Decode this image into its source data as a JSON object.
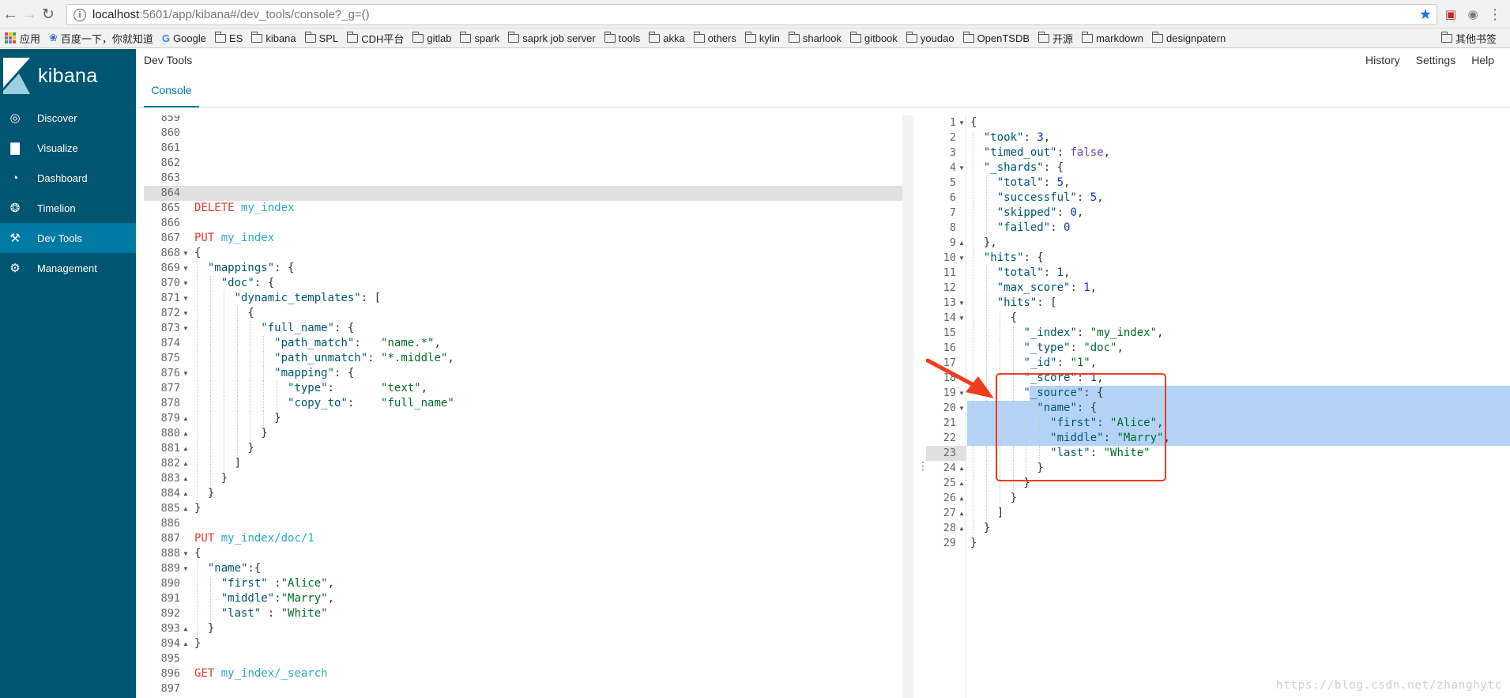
{
  "browser": {
    "url_host": "localhost",
    "url_path": ":5601/app/kibana#/dev_tools/console?_g=()",
    "bookmarks": [
      {
        "label": "应用",
        "type": "apps"
      },
      {
        "label": "百度一下，你就知道",
        "type": "paw"
      },
      {
        "label": "Google",
        "type": "google"
      },
      {
        "label": "ES",
        "type": "folder"
      },
      {
        "label": "kibana",
        "type": "folder"
      },
      {
        "label": "SPL",
        "type": "folder"
      },
      {
        "label": "CDH平台",
        "type": "folder"
      },
      {
        "label": "gitlab",
        "type": "folder"
      },
      {
        "label": "spark",
        "type": "folder"
      },
      {
        "label": "saprk job server",
        "type": "folder"
      },
      {
        "label": "tools",
        "type": "folder"
      },
      {
        "label": "akka",
        "type": "folder"
      },
      {
        "label": "others",
        "type": "folder"
      },
      {
        "label": "kylin",
        "type": "folder"
      },
      {
        "label": "sharlook",
        "type": "folder"
      },
      {
        "label": "gitbook",
        "type": "folder"
      },
      {
        "label": "youdao",
        "type": "folder"
      },
      {
        "label": "OpenTSDB",
        "type": "folder"
      },
      {
        "label": "开源",
        "type": "folder"
      },
      {
        "label": "markdown",
        "type": "folder"
      },
      {
        "label": "designpatern",
        "type": "folder"
      }
    ],
    "other_bookmarks": "其他书签"
  },
  "sidebar": {
    "logo_text": "kibana",
    "items": [
      {
        "label": "Discover",
        "icon": "compass-icon",
        "active": false
      },
      {
        "label": "Visualize",
        "icon": "bar-chart-icon",
        "active": false
      },
      {
        "label": "Dashboard",
        "icon": "dashboard-icon",
        "active": false
      },
      {
        "label": "Timelion",
        "icon": "timelion-icon",
        "active": false
      },
      {
        "label": "Dev Tools",
        "icon": "wrench-icon",
        "active": true
      },
      {
        "label": "Management",
        "icon": "gear-icon",
        "active": false
      }
    ]
  },
  "header": {
    "title": "Dev Tools",
    "actions": [
      "History",
      "Settings",
      "Help"
    ],
    "tab": "Console"
  },
  "request_editor": {
    "lines": [
      {
        "n": "859",
        "fold": "",
        "tokens": []
      },
      {
        "n": "860",
        "fold": "",
        "tokens": []
      },
      {
        "n": "861",
        "fold": "",
        "tokens": []
      },
      {
        "n": "862",
        "fold": "",
        "tokens": []
      },
      {
        "n": "863",
        "fold": "",
        "tokens": []
      },
      {
        "n": "864",
        "fold": "",
        "tokens": []
      },
      {
        "n": "865",
        "fold": "",
        "tokens": [
          [
            "m",
            "DELETE"
          ],
          [
            "p",
            " "
          ],
          [
            "u",
            "my_index"
          ]
        ]
      },
      {
        "n": "866",
        "fold": "",
        "tokens": []
      },
      {
        "n": "867",
        "fold": "",
        "tokens": [
          [
            "m",
            "PUT"
          ],
          [
            "p",
            " "
          ],
          [
            "u",
            "my_index"
          ]
        ]
      },
      {
        "n": "868",
        "fold": "open",
        "tokens": [
          [
            "p",
            "{"
          ]
        ]
      },
      {
        "n": "869",
        "fold": "open",
        "tokens": [
          [
            "p",
            "  "
          ],
          [
            "k",
            "\"mappings\""
          ],
          [
            "p",
            ": {"
          ]
        ]
      },
      {
        "n": "870",
        "fold": "open",
        "tokens": [
          [
            "p",
            "    "
          ],
          [
            "k",
            "\"doc\""
          ],
          [
            "p",
            ": {"
          ]
        ]
      },
      {
        "n": "871",
        "fold": "open",
        "tokens": [
          [
            "p",
            "      "
          ],
          [
            "k",
            "\"dynamic_templates\""
          ],
          [
            "p",
            ": ["
          ]
        ]
      },
      {
        "n": "872",
        "fold": "open",
        "tokens": [
          [
            "p",
            "        {"
          ]
        ]
      },
      {
        "n": "873",
        "fold": "open",
        "tokens": [
          [
            "p",
            "          "
          ],
          [
            "k",
            "\"full_name\""
          ],
          [
            "p",
            ": {"
          ]
        ]
      },
      {
        "n": "874",
        "fold": "",
        "tokens": [
          [
            "p",
            "            "
          ],
          [
            "k",
            "\"path_match\""
          ],
          [
            "p",
            ":   "
          ],
          [
            "s",
            "\"name.*\""
          ],
          [
            "p",
            ","
          ]
        ]
      },
      {
        "n": "875",
        "fold": "",
        "tokens": [
          [
            "p",
            "            "
          ],
          [
            "k",
            "\"path_unmatch\""
          ],
          [
            "p",
            ": "
          ],
          [
            "s",
            "\"*.middle\""
          ],
          [
            "p",
            ","
          ]
        ]
      },
      {
        "n": "876",
        "fold": "open",
        "tokens": [
          [
            "p",
            "            "
          ],
          [
            "k",
            "\"mapping\""
          ],
          [
            "p",
            ": {"
          ]
        ]
      },
      {
        "n": "877",
        "fold": "",
        "tokens": [
          [
            "p",
            "              "
          ],
          [
            "k",
            "\"type\""
          ],
          [
            "p",
            ":       "
          ],
          [
            "s",
            "\"text\""
          ],
          [
            "p",
            ","
          ]
        ]
      },
      {
        "n": "878",
        "fold": "",
        "tokens": [
          [
            "p",
            "              "
          ],
          [
            "k",
            "\"copy_to\""
          ],
          [
            "p",
            ":    "
          ],
          [
            "s",
            "\"full_name\""
          ]
        ]
      },
      {
        "n": "879",
        "fold": "close",
        "tokens": [
          [
            "p",
            "            }"
          ]
        ]
      },
      {
        "n": "880",
        "fold": "close",
        "tokens": [
          [
            "p",
            "          }"
          ]
        ]
      },
      {
        "n": "881",
        "fold": "close",
        "tokens": [
          [
            "p",
            "        }"
          ]
        ]
      },
      {
        "n": "882",
        "fold": "close",
        "tokens": [
          [
            "p",
            "      ]"
          ]
        ]
      },
      {
        "n": "883",
        "fold": "close",
        "tokens": [
          [
            "p",
            "    }"
          ]
        ]
      },
      {
        "n": "884",
        "fold": "close",
        "tokens": [
          [
            "p",
            "  }"
          ]
        ]
      },
      {
        "n": "885",
        "fold": "close",
        "tokens": [
          [
            "p",
            "}"
          ]
        ]
      },
      {
        "n": "886",
        "fold": "",
        "tokens": []
      },
      {
        "n": "887",
        "fold": "",
        "tokens": [
          [
            "m",
            "PUT"
          ],
          [
            "p",
            " "
          ],
          [
            "u",
            "my_index/doc/1"
          ]
        ]
      },
      {
        "n": "888",
        "fold": "open",
        "tokens": [
          [
            "p",
            "{"
          ]
        ]
      },
      {
        "n": "889",
        "fold": "open",
        "tokens": [
          [
            "p",
            "  "
          ],
          [
            "k",
            "\"name\""
          ],
          [
            "p",
            ":{"
          ]
        ]
      },
      {
        "n": "890",
        "fold": "",
        "tokens": [
          [
            "p",
            "    "
          ],
          [
            "k",
            "\"first\""
          ],
          [
            "p",
            " :"
          ],
          [
            "s",
            "\"Alice\""
          ],
          [
            "p",
            ","
          ]
        ]
      },
      {
        "n": "891",
        "fold": "",
        "tokens": [
          [
            "p",
            "    "
          ],
          [
            "k",
            "\"middle\""
          ],
          [
            "p",
            ":"
          ],
          [
            "s",
            "\"Marry\""
          ],
          [
            "p",
            ","
          ]
        ]
      },
      {
        "n": "892",
        "fold": "",
        "tokens": [
          [
            "p",
            "    "
          ],
          [
            "k",
            "\"last\""
          ],
          [
            "p",
            " : "
          ],
          [
            "s",
            "\"White\""
          ]
        ]
      },
      {
        "n": "893",
        "fold": "close",
        "tokens": [
          [
            "p",
            "  }"
          ]
        ]
      },
      {
        "n": "894",
        "fold": "close",
        "tokens": [
          [
            "p",
            "}"
          ]
        ]
      },
      {
        "n": "895",
        "fold": "",
        "tokens": []
      },
      {
        "n": "896",
        "fold": "",
        "tokens": [
          [
            "m",
            "GET"
          ],
          [
            "p",
            " "
          ],
          [
            "u",
            "my_index/_search"
          ]
        ]
      },
      {
        "n": "897",
        "fold": "",
        "tokens": []
      }
    ]
  },
  "response_editor": {
    "lines": [
      {
        "n": "1",
        "fold": "open",
        "tokens": [
          [
            "p",
            "{"
          ]
        ]
      },
      {
        "n": "2",
        "fold": "",
        "tokens": [
          [
            "p",
            "  "
          ],
          [
            "k",
            "\"took\""
          ],
          [
            "p",
            ": "
          ],
          [
            "n",
            "3"
          ],
          [
            "p",
            ","
          ]
        ]
      },
      {
        "n": "3",
        "fold": "",
        "tokens": [
          [
            "p",
            "  "
          ],
          [
            "k",
            "\"timed_out\""
          ],
          [
            "p",
            ": "
          ],
          [
            "b",
            "false"
          ],
          [
            "p",
            ","
          ]
        ]
      },
      {
        "n": "4",
        "fold": "open",
        "tokens": [
          [
            "p",
            "  "
          ],
          [
            "k",
            "\"_shards\""
          ],
          [
            "p",
            ": {"
          ]
        ]
      },
      {
        "n": "5",
        "fold": "",
        "tokens": [
          [
            "p",
            "    "
          ],
          [
            "k",
            "\"total\""
          ],
          [
            "p",
            ": "
          ],
          [
            "n",
            "5"
          ],
          [
            "p",
            ","
          ]
        ]
      },
      {
        "n": "6",
        "fold": "",
        "tokens": [
          [
            "p",
            "    "
          ],
          [
            "k",
            "\"successful\""
          ],
          [
            "p",
            ": "
          ],
          [
            "n",
            "5"
          ],
          [
            "p",
            ","
          ]
        ]
      },
      {
        "n": "7",
        "fold": "",
        "tokens": [
          [
            "p",
            "    "
          ],
          [
            "k",
            "\"skipped\""
          ],
          [
            "p",
            ": "
          ],
          [
            "n",
            "0"
          ],
          [
            "p",
            ","
          ]
        ]
      },
      {
        "n": "8",
        "fold": "",
        "tokens": [
          [
            "p",
            "    "
          ],
          [
            "k",
            "\"failed\""
          ],
          [
            "p",
            ": "
          ],
          [
            "n",
            "0"
          ]
        ]
      },
      {
        "n": "9",
        "fold": "close",
        "tokens": [
          [
            "p",
            "  },"
          ]
        ]
      },
      {
        "n": "10",
        "fold": "open",
        "tokens": [
          [
            "p",
            "  "
          ],
          [
            "k",
            "\"hits\""
          ],
          [
            "p",
            ": {"
          ]
        ]
      },
      {
        "n": "11",
        "fold": "",
        "tokens": [
          [
            "p",
            "    "
          ],
          [
            "k",
            "\"total\""
          ],
          [
            "p",
            ": "
          ],
          [
            "n",
            "1"
          ],
          [
            "p",
            ","
          ]
        ]
      },
      {
        "n": "12",
        "fold": "",
        "tokens": [
          [
            "p",
            "    "
          ],
          [
            "k",
            "\"max_score\""
          ],
          [
            "p",
            ": "
          ],
          [
            "n",
            "1"
          ],
          [
            "p",
            ","
          ]
        ]
      },
      {
        "n": "13",
        "fold": "open",
        "tokens": [
          [
            "p",
            "    "
          ],
          [
            "k",
            "\"hits\""
          ],
          [
            "p",
            ": ["
          ]
        ]
      },
      {
        "n": "14",
        "fold": "open",
        "tokens": [
          [
            "p",
            "      {"
          ]
        ]
      },
      {
        "n": "15",
        "fold": "",
        "tokens": [
          [
            "p",
            "        "
          ],
          [
            "k",
            "\"_index\""
          ],
          [
            "p",
            ": "
          ],
          [
            "s",
            "\"my_index\""
          ],
          [
            "p",
            ","
          ]
        ]
      },
      {
        "n": "16",
        "fold": "",
        "tokens": [
          [
            "p",
            "        "
          ],
          [
            "k",
            "\"_type\""
          ],
          [
            "p",
            ": "
          ],
          [
            "s",
            "\"doc\""
          ],
          [
            "p",
            ","
          ]
        ]
      },
      {
        "n": "17",
        "fold": "",
        "tokens": [
          [
            "p",
            "        "
          ],
          [
            "k",
            "\"_id\""
          ],
          [
            "p",
            ": "
          ],
          [
            "s",
            "\"1\""
          ],
          [
            "p",
            ","
          ]
        ]
      },
      {
        "n": "18",
        "fold": "",
        "tokens": [
          [
            "p",
            "        "
          ],
          [
            "k",
            "\"_score\""
          ],
          [
            "p",
            ": "
          ],
          [
            "n",
            "1"
          ],
          [
            "p",
            ","
          ]
        ]
      },
      {
        "n": "19",
        "fold": "open",
        "tokens": [
          [
            "p",
            "        "
          ],
          [
            "k",
            "\"_source\""
          ],
          [
            "p",
            ": {"
          ]
        ]
      },
      {
        "n": "20",
        "fold": "open",
        "tokens": [
          [
            "p",
            "          "
          ],
          [
            "k",
            "\"name\""
          ],
          [
            "p",
            ": {"
          ]
        ]
      },
      {
        "n": "21",
        "fold": "",
        "tokens": [
          [
            "p",
            "            "
          ],
          [
            "k",
            "\"first\""
          ],
          [
            "p",
            ": "
          ],
          [
            "s",
            "\"Alice\""
          ],
          [
            "p",
            ","
          ]
        ]
      },
      {
        "n": "22",
        "fold": "",
        "tokens": [
          [
            "p",
            "            "
          ],
          [
            "k",
            "\"middle\""
          ],
          [
            "p",
            ": "
          ],
          [
            "s",
            "\"Marry\""
          ],
          [
            "p",
            ","
          ]
        ]
      },
      {
        "n": "23",
        "fold": "",
        "tokens": [
          [
            "p",
            "            "
          ],
          [
            "k",
            "\"last\""
          ],
          [
            "p",
            ": "
          ],
          [
            "s",
            "\"White\""
          ]
        ]
      },
      {
        "n": "24",
        "fold": "close",
        "tokens": [
          [
            "p",
            "          }"
          ]
        ]
      },
      {
        "n": "25",
        "fold": "close",
        "tokens": [
          [
            "p",
            "        }"
          ]
        ]
      },
      {
        "n": "26",
        "fold": "close",
        "tokens": [
          [
            "p",
            "      }"
          ]
        ]
      },
      {
        "n": "27",
        "fold": "close",
        "tokens": [
          [
            "p",
            "    ]"
          ]
        ]
      },
      {
        "n": "28",
        "fold": "close",
        "tokens": [
          [
            "p",
            "  }"
          ]
        ]
      },
      {
        "n": "29",
        "fold": "",
        "tokens": [
          [
            "p",
            "}"
          ]
        ]
      }
    ]
  },
  "watermark": "https://blog.csdn.net/zhanghytc",
  "colors": {
    "sidebar_bg": "#005571",
    "sidebar_active": "#0079a5",
    "method": "#e0402e",
    "url": "#2aa7c8",
    "annotation": "#f03c1e",
    "selection": "#b4d3f7"
  }
}
